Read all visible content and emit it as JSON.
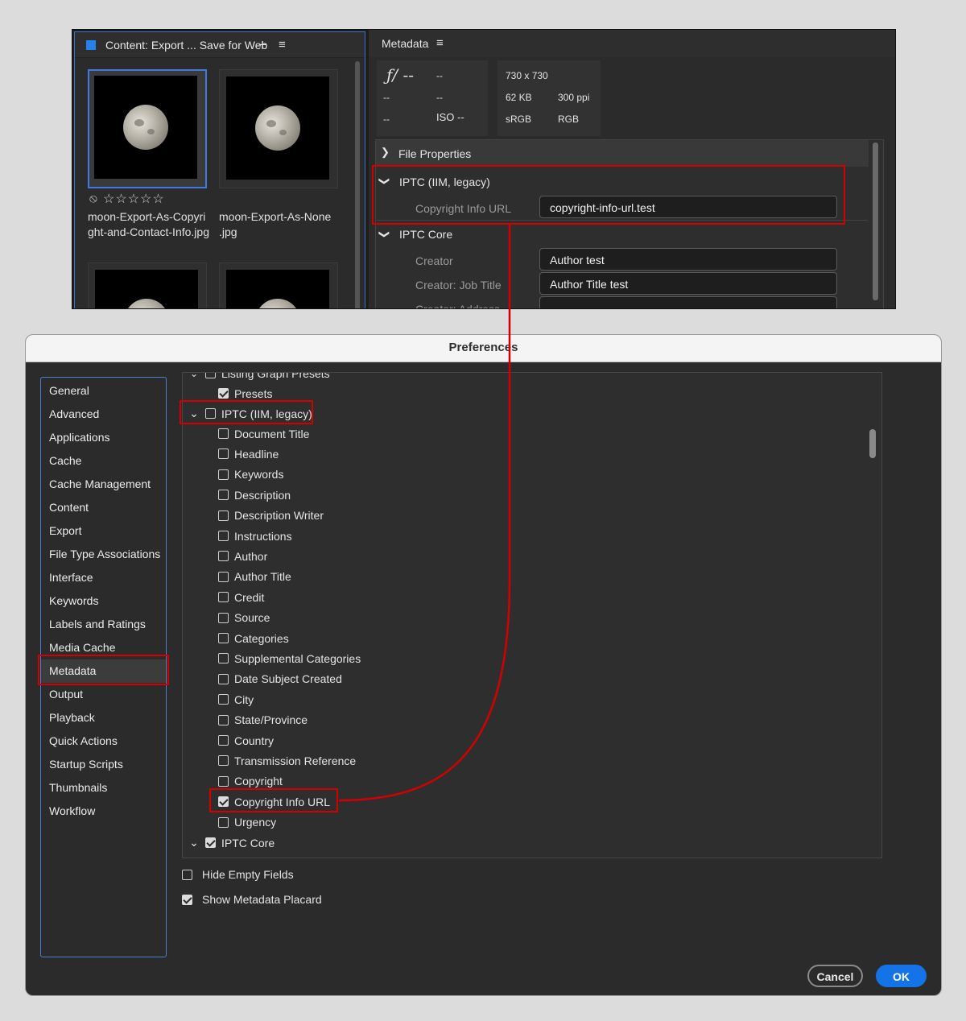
{
  "content_panel": {
    "title": "Content: Export ... Save for Web",
    "add_icon": "+",
    "menu_icon": "≡",
    "thumbnails": [
      {
        "name_line1": "moon-Export-As-Copyri",
        "name_line2": "ght-and-Contact-Info.jpg",
        "selected": true
      },
      {
        "name_line1": "moon-Export-As-None",
        "name_line2": ".jpg",
        "selected": false
      }
    ],
    "rating_reject": "⦸",
    "rating_stars": "☆☆☆☆☆"
  },
  "metadata_panel": {
    "title": "Metadata",
    "menu_icon": "≡",
    "camera": {
      "aperture": "ƒ/ --",
      "shutter": "--",
      "r2c1": "--",
      "r2c2": "--",
      "r3c1": "--",
      "iso": "ISO --"
    },
    "file": {
      "dimensions": "730 x 730",
      "size": "62 KB",
      "resolution": "300 ppi",
      "color_profile": "sRGB",
      "color_mode": "RGB"
    },
    "sections": {
      "file_properties": "File Properties",
      "iptc_legacy": "IPTC (IIM, legacy)",
      "iptc_core": "IPTC Core"
    },
    "fields": {
      "copyright_info_url_label": "Copyright Info URL",
      "copyright_info_url_value": "copyright-info-url.test",
      "creator_label": "Creator",
      "creator_value": "Author test",
      "job_title_label": "Creator: Job Title",
      "job_title_value": "Author Title test",
      "address_label": "Creator: Address"
    }
  },
  "preferences": {
    "title": "Preferences",
    "sidebar": [
      "General",
      "Advanced",
      "Applications",
      "Cache",
      "Cache Management",
      "Content",
      "Export",
      "File Type Associations",
      "Interface",
      "Keywords",
      "Labels and Ratings",
      "Media Cache",
      "Metadata",
      "Output",
      "Playback",
      "Quick Actions",
      "Startup Scripts",
      "Thumbnails",
      "Workflow"
    ],
    "active_item": "Metadata",
    "tree": {
      "listing_graph_presets": "Listing Graph Presets",
      "presets": "Presets",
      "iptc_legacy": "IPTC (IIM, legacy)",
      "legacy_fields": [
        {
          "label": "Document Title",
          "checked": false
        },
        {
          "label": "Headline",
          "checked": false
        },
        {
          "label": "Keywords",
          "checked": false
        },
        {
          "label": "Description",
          "checked": false
        },
        {
          "label": "Description Writer",
          "checked": false
        },
        {
          "label": "Instructions",
          "checked": false
        },
        {
          "label": "Author",
          "checked": false
        },
        {
          "label": "Author Title",
          "checked": false
        },
        {
          "label": "Credit",
          "checked": false
        },
        {
          "label": "Source",
          "checked": false
        },
        {
          "label": "Categories",
          "checked": false
        },
        {
          "label": "Supplemental Categories",
          "checked": false
        },
        {
          "label": "Date Subject Created",
          "checked": false
        },
        {
          "label": "City",
          "checked": false
        },
        {
          "label": "State/Province",
          "checked": false
        },
        {
          "label": "Country",
          "checked": false
        },
        {
          "label": "Transmission Reference",
          "checked": false
        },
        {
          "label": "Copyright",
          "checked": false
        },
        {
          "label": "Copyright Info URL",
          "checked": true
        },
        {
          "label": "Urgency",
          "checked": false
        }
      ],
      "iptc_core": "IPTC Core"
    },
    "options": {
      "hide_empty_fields": "Hide Empty Fields",
      "show_placard": "Show Metadata Placard"
    },
    "buttons": {
      "cancel": "Cancel",
      "ok": "OK"
    }
  },
  "colors": {
    "accent": "#1473e6",
    "highlight": "#d40000",
    "selection": "#3e7ae0"
  }
}
